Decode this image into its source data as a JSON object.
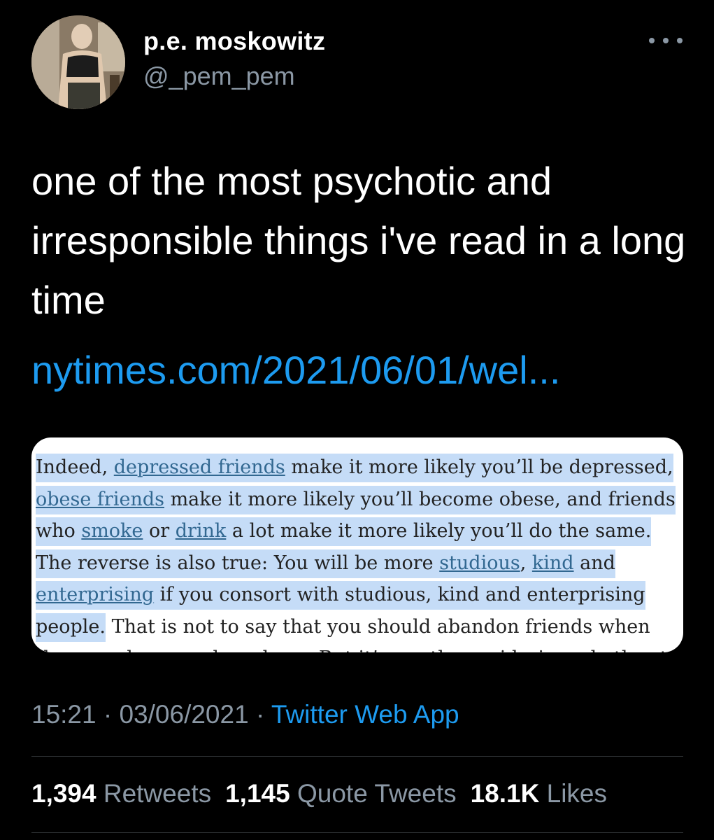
{
  "user": {
    "display_name": "p.e. moskowitz",
    "handle": "@_pem_pem"
  },
  "tweet": {
    "text": "one of the most psychotic and irresponsible things i've read in a long time",
    "link_text": "nytimes.com/2021/06/01/wel..."
  },
  "article_excerpt": {
    "line1_a": "Indeed, ",
    "line1_link": "depressed friends",
    "line1_b": " make it more likely you’ll be depressed,",
    "line2_link": "obese friends",
    "line2_b": " make it more likely you’ll become obese, and friends",
    "line3_a": "who ",
    "line3_link1": "smoke",
    "line3_mid": " or ",
    "line3_link2": "drink",
    "line3_b": " a lot make it more likely you’ll do the same.",
    "line4_a": "The reverse is also true: You will be more ",
    "line4_link1": "studious",
    "line4_mid": ", ",
    "line4_link2": "kind",
    "line4_b": " and",
    "line5_link": "enterprising",
    "line5_b": " if you consort with studious, kind and enterprising",
    "line6_hl": "people.",
    "line6_b": " That is not to say that you should abandon friends when",
    "line7_partial": "they are depressed or obese. But it’s worth considering whether to become"
  },
  "meta": {
    "time": "15:21",
    "date": "03/06/2021",
    "separator": " · ",
    "source": "Twitter Web App"
  },
  "stats": {
    "retweets_count": "1,394",
    "retweets_label": "Retweets",
    "quote_count": "1,145",
    "quote_label": "Quote Tweets",
    "likes_count": "18.1K",
    "likes_label": "Likes"
  },
  "colors": {
    "background": "#000000",
    "link": "#1d9bf0",
    "secondary_text": "#8b98a5",
    "highlight": "#c5dcf7"
  },
  "icons": {
    "more": "more-horizontal-icon"
  }
}
